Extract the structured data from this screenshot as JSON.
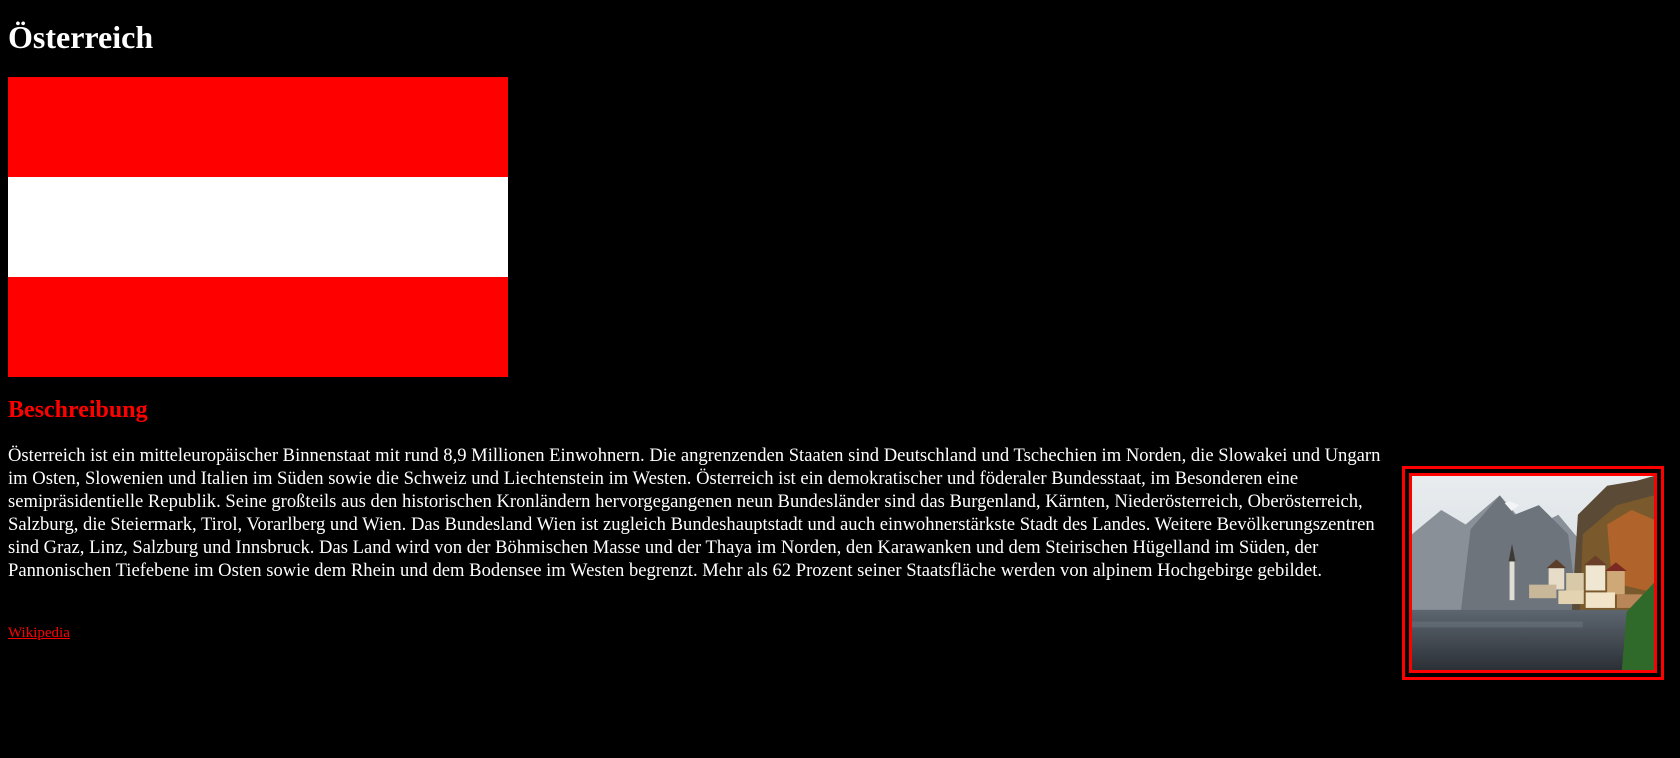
{
  "page": {
    "title": "Österreich",
    "flag_colors": [
      "#ff0000",
      "#ffffff",
      "#ff0000"
    ],
    "section_heading": "Beschreibung",
    "description": "Österreich ist ein mitteleuropäischer Binnenstaat mit rund 8,9 Millionen Einwohnern. Die angrenzenden Staaten sind Deutschland und Tschechien im Norden, die Slowakei und Ungarn im Osten, Slowenien und Italien im Süden sowie die Schweiz und Liechtenstein im Westen. Österreich ist ein demokratischer und föderaler Bundesstaat, im Besonderen eine semipräsidentielle Republik. Seine großteils aus den historischen Kronländern hervorgegangenen neun Bundesländer sind das Burgenland, Kärnten, Niederösterreich, Oberösterreich, Salzburg, die Steiermark, Tirol, Vorarlberg und Wien. Das Bundesland Wien ist zugleich Bundeshauptstadt und auch einwohnerstärkste Stadt des Landes. Weitere Bevölkerungszentren sind Graz, Linz, Salzburg und Innsbruck. Das Land wird von der Böhmischen Masse und der Thaya im Norden, den Karawanken und dem Steirischen Hügelland im Süden, der Pannonischen Tiefebene im Osten sowie dem Rhein und dem Bodensee im Westen begrenzt. Mehr als 62 Prozent seiner Staatsfläche werden von alpinem Hochgebirge gebildet.",
    "link_text": "Wikipedia",
    "accent_color": "#ff0000",
    "background_color": "#000000"
  }
}
